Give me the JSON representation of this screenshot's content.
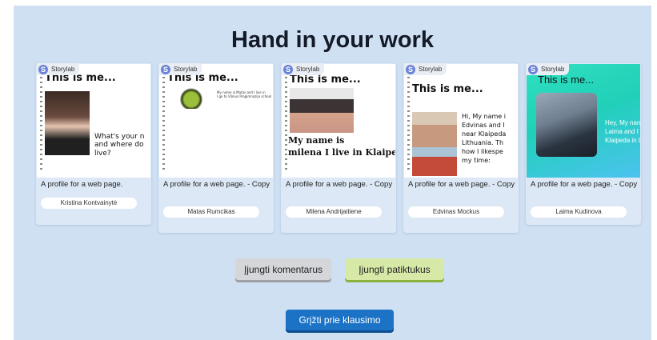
{
  "page": {
    "title": "Hand in your work"
  },
  "brand": {
    "name": "Storylab",
    "logo_letter": "S"
  },
  "cards": [
    {
      "thumb_title": "This is me...",
      "thumb_text": [
        "What's your n",
        "and where do",
        "live?"
      ],
      "caption": "A profile for a web page.",
      "author": "Kristina Kontvainytė"
    },
    {
      "thumb_title": "This is me...",
      "thumb_text": [
        "My name is Matas and I live in",
        "I go to Vilnius Progimnazija school"
      ],
      "caption": "A profile for a web page. - Copy",
      "author": "Matas Rumcikas"
    },
    {
      "thumb_title": "This is me...",
      "thumb_text": [
        "My  name is",
        "milena   I live in Klaipe"
      ],
      "caption": "A profile for a web page. - Copy",
      "author": "Milena Andrijaitiene"
    },
    {
      "thumb_title": "This is me...",
      "thumb_text": [
        "Hi, My name i",
        "Edvinas and I",
        "near Klaipeda",
        "Lithuania. Th",
        "how I likespe",
        "my time:"
      ],
      "caption": "A profile for a web page. - Copy",
      "author": "Edvinas Mockus"
    },
    {
      "thumb_title": "This is me...",
      "thumb_text": [
        "Hey, My nan",
        "Laima and I",
        "Klaipeda in L"
      ],
      "caption": "A profile for a web page. - Copy",
      "author": "Laima Kudinova"
    }
  ],
  "buttons": {
    "comments": "Įjungti komentarus",
    "likes": "Įjungti patiktukus",
    "back": "Grįžti prie klausimo"
  },
  "colors": {
    "background": "#cfe0f3",
    "primary": "#1c73c6",
    "likes_button": "#d7e9a6",
    "comments_button": "#d5d6d9"
  }
}
